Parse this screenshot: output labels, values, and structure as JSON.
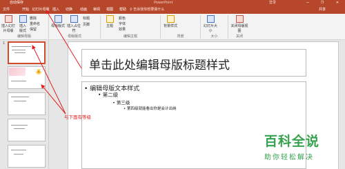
{
  "titlebar": {
    "filename": "自动保存",
    "appname": "PowerPoint",
    "user": "登录",
    "buttons": [
      "—",
      "❐",
      "✕"
    ]
  },
  "tabs": [
    "文件",
    "开始",
    "幻灯片母版",
    "插入",
    "切换",
    "动画",
    "审阅",
    "视图",
    "帮助"
  ],
  "active_tab_index": 2,
  "search_placeholder": "♀ 告诉我你想要做什么",
  "share_label": "共享",
  "ribbon": {
    "buttons": [
      {
        "label": "插入幻灯片母版",
        "color": "red"
      },
      {
        "label": "插入版式",
        "color": "blue"
      },
      {
        "label": "删除",
        "color": "red"
      },
      {
        "label": "重命名",
        "color": ""
      },
      {
        "label": "保留",
        "color": ""
      },
      {
        "label": "母版版式",
        "color": "blue"
      },
      {
        "label": "插入占位符",
        "color": "blue"
      },
      {
        "label": "标题",
        "color": ""
      },
      {
        "label": "页脚",
        "color": ""
      },
      {
        "label": "主题",
        "color": "yellow"
      },
      {
        "label": "颜色",
        "color": "green"
      },
      {
        "label": "字体",
        "color": ""
      },
      {
        "label": "效果",
        "color": "purple"
      },
      {
        "label": "背景样式",
        "color": "yellow"
      },
      {
        "label": "幻灯片大小",
        "color": "blue"
      },
      {
        "label": "关闭母版视图",
        "color": "red"
      }
    ],
    "groups": [
      "编辑母版",
      "母版版式",
      "编辑主题",
      "背景",
      "大小",
      "关闭"
    ]
  },
  "thumbnails": [
    "1",
    "",
    "",
    "",
    ""
  ],
  "slide": {
    "title": "单击此处编辑母版标题样式",
    "levels": [
      "• 编辑母版文本样式",
      "• 第二级",
      "• 第三级",
      "• 第四级就能看出你是会计出纳"
    ]
  },
  "annotation": "与下面有等级",
  "watermark": {
    "big": "百科全说",
    "small": "助你轻松解决"
  },
  "colors": {
    "accent": "#b7472a",
    "annotation": "#e02020",
    "watermark": "#35a24d"
  }
}
